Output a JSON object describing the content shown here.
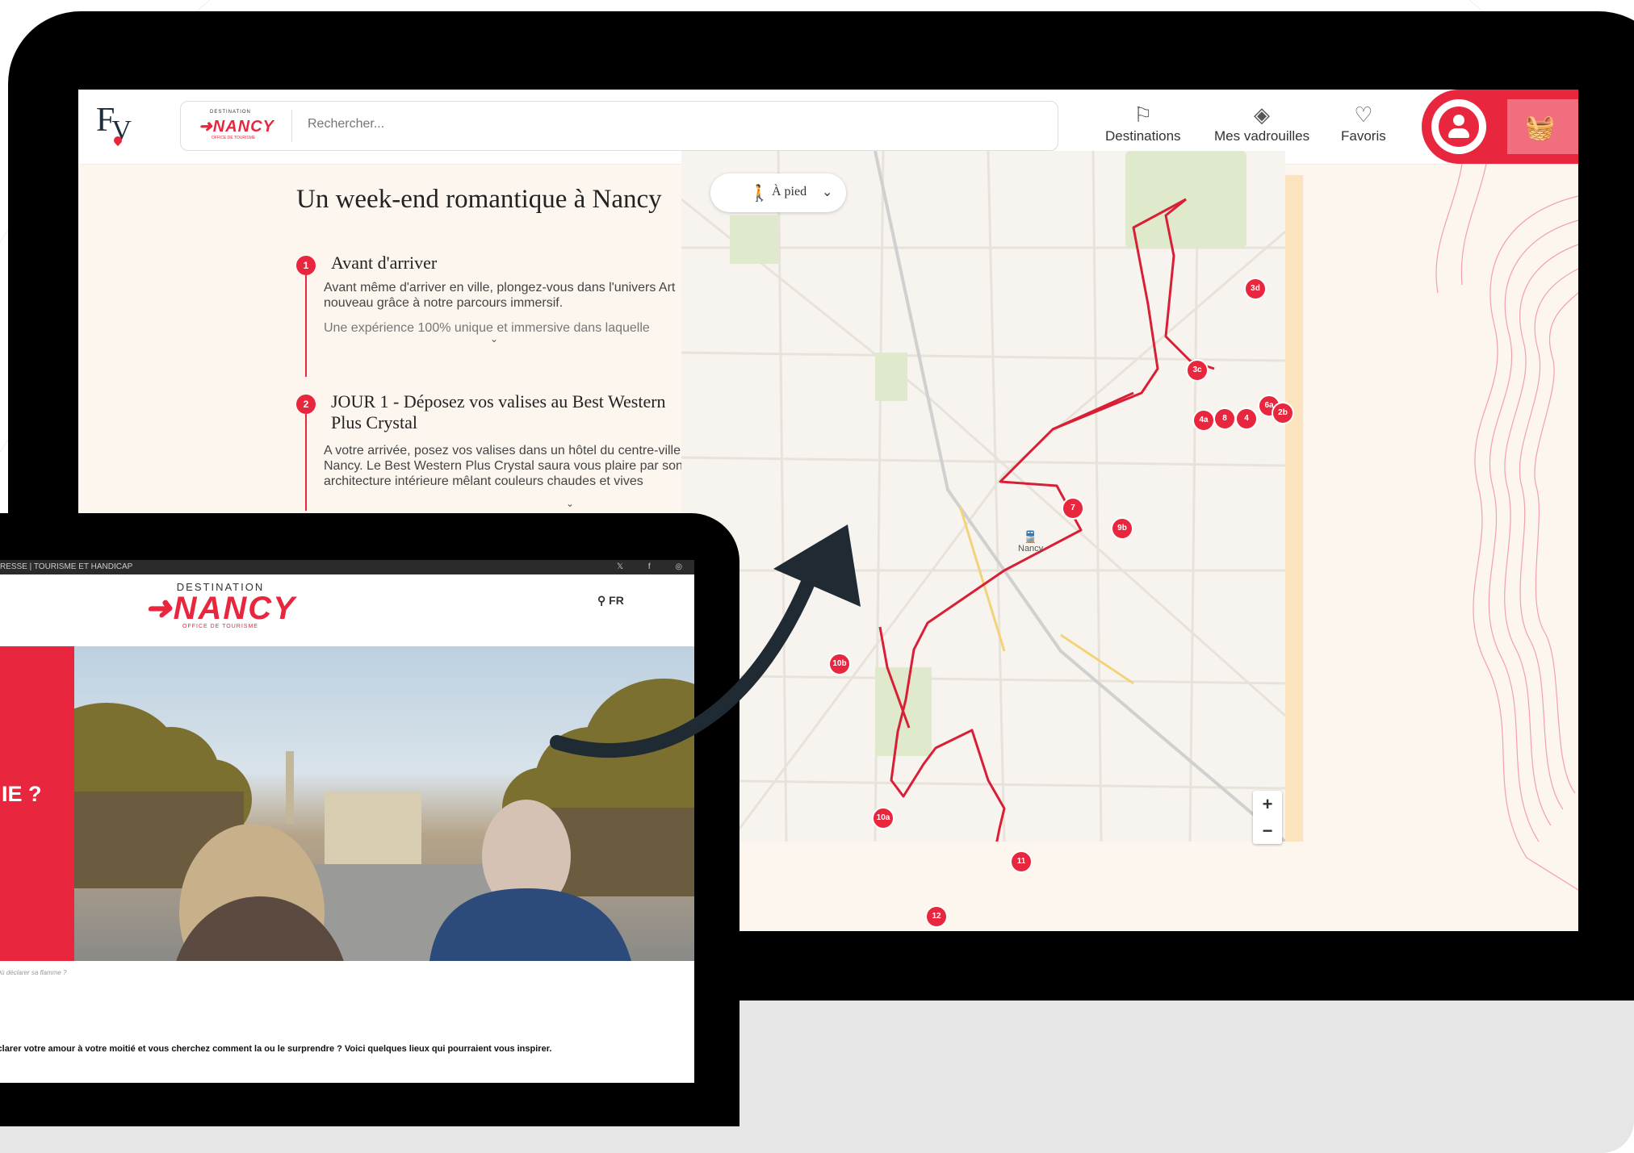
{
  "colors": {
    "accent": "#e8273f",
    "dark": "#000000",
    "page_bg": "#fcf6ef",
    "route": "#d81f36"
  },
  "app": {
    "logo_letters": "FV",
    "search": {
      "brand_top": "DESTINATION",
      "brand_name": "NANCY",
      "brand_sub": "OFFICE DE TOURISME",
      "placeholder": "Rechercher..."
    },
    "nav": [
      {
        "label": "Destinations",
        "icon": "flag-icon"
      },
      {
        "label": "Mes vadrouilles",
        "icon": "compass-pin-icon"
      },
      {
        "label": "Favoris",
        "icon": "heart-icon"
      }
    ]
  },
  "itinerary": {
    "title": "Un week-end romantique à Nancy",
    "steps": [
      {
        "num": "1",
        "title": "Avant d'arriver",
        "text": "Avant même d'arriver en ville, plongez-vous dans l'univers Art nouveau grâce à notre parcours immersif.",
        "text2": "Une expérience 100% unique et immersive dans laquelle"
      },
      {
        "num": "2",
        "title": "JOUR 1 - Déposez vos valises au Best Western Plus Crystal",
        "text": "A votre arrivée, posez vos valises dans un hôtel du centre-ville de Nancy. Le Best Western Plus Crystal saura vous plaire par son architecture intérieure mêlant couleurs chaudes et vives"
      }
    ]
  },
  "map": {
    "mode_label": "À pied",
    "station_label": "Nancy",
    "zoom_in": "+",
    "zoom_out": "−",
    "markers": [
      "3d",
      "3c",
      "4a",
      "8",
      "4",
      "6a",
      "2b",
      "7",
      "9b",
      "10b",
      "10a",
      "11",
      "12"
    ]
  },
  "tablet": {
    "top_links": "RESSE  |  TOURISME ET HANDICAP",
    "socials": "𝕏 f ◎",
    "logo_top": "DESTINATION",
    "logo_name": "NANCY",
    "logo_sub": "OFFICE DE TOURISME",
    "lang": "FR",
    "hero_text": "IE ?",
    "breadcrumb": "> Où déclarer sa flamme ?",
    "body": "clarer votre amour à votre moitié et vous cherchez comment la ou le surprendre ? Voici quelques lieux qui pourraient vous inspirer."
  }
}
